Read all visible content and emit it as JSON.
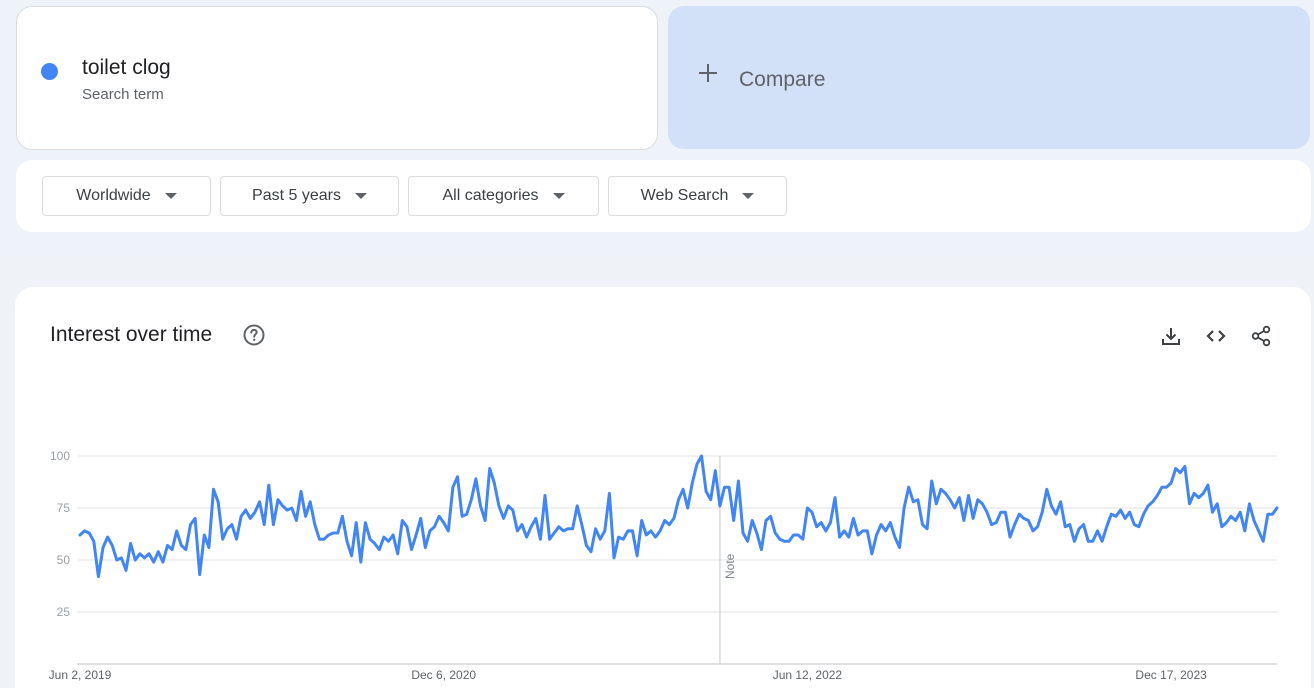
{
  "search_term": {
    "name": "toilet clog",
    "subtitle": "Search term",
    "color": "#4285f4"
  },
  "compare": {
    "label": "Compare"
  },
  "filters": {
    "region": "Worldwide",
    "period": "Past 5 years",
    "category": "All categories",
    "property": "Web Search"
  },
  "chart_card": {
    "title": "Interest over time",
    "note": "Note",
    "icons": [
      "help-icon",
      "download-icon",
      "embed-code-icon",
      "share-icon"
    ]
  },
  "chart_data": {
    "type": "line",
    "title": "Interest over time",
    "xlabel": "",
    "ylabel": "",
    "ylim": [
      0,
      100
    ],
    "yticks": [
      25,
      50,
      75,
      100
    ],
    "x_tick_labels": [
      "Jun 2, 2019",
      "Dec 6, 2020",
      "Jun 12, 2022",
      "Dec 17, 2023"
    ],
    "x_tick_index": [
      0,
      79,
      158,
      237
    ],
    "note_index": 139,
    "grid": true,
    "legend": "none",
    "series": [
      {
        "color": "#4285f4",
        "values": [
          62,
          64,
          63,
          59,
          42,
          56,
          61,
          57,
          50,
          51,
          45,
          58,
          50,
          53,
          51,
          53,
          49,
          54,
          49,
          57,
          55,
          64,
          57,
          55,
          67,
          70,
          43,
          62,
          56,
          84,
          78,
          60,
          65,
          67,
          60,
          71,
          74,
          70,
          73,
          78,
          67,
          86,
          67,
          79,
          76,
          74,
          75,
          69,
          83,
          71,
          78,
          67,
          60,
          60,
          62,
          63,
          63,
          71,
          59,
          52,
          68,
          49,
          68,
          60,
          58,
          55,
          61,
          59,
          62,
          53,
          69,
          66,
          55,
          62,
          70,
          56,
          64,
          66,
          71,
          68,
          64,
          85,
          90,
          71,
          72,
          79,
          89,
          76,
          69,
          94,
          87,
          76,
          70,
          76,
          74,
          64,
          67,
          61,
          66,
          70,
          60,
          81,
          60,
          63,
          66,
          64,
          65,
          65,
          76,
          67,
          57,
          54,
          65,
          60,
          64,
          82,
          51,
          61,
          60,
          64,
          64,
          52,
          69,
          62,
          64,
          61,
          64,
          69,
          67,
          70,
          79,
          84,
          75,
          87,
          96,
          100,
          83,
          79,
          93,
          76,
          85,
          85,
          69,
          88,
          63,
          59,
          69,
          63,
          55,
          69,
          71,
          63,
          60,
          59,
          59,
          62,
          62,
          60,
          75,
          73,
          66,
          68,
          64,
          68,
          80,
          61,
          64,
          61,
          70,
          62,
          64,
          64,
          53,
          62,
          67,
          64,
          68,
          61,
          56,
          75,
          85,
          78,
          79,
          67,
          65,
          88,
          77,
          84,
          82,
          79,
          75,
          80,
          69,
          81,
          70,
          79,
          77,
          73,
          67,
          68,
          73,
          73,
          61,
          67,
          72,
          70,
          69,
          64,
          66,
          73,
          84,
          76,
          72,
          78,
          66,
          67,
          59,
          65,
          67,
          59,
          59,
          64,
          59,
          66,
          72,
          71,
          74,
          70,
          73,
          67,
          66,
          72,
          76,
          78,
          81,
          85,
          85,
          87,
          94,
          92,
          95,
          77,
          82,
          80,
          82,
          86,
          73,
          77,
          66,
          68,
          71,
          69,
          73,
          64,
          77,
          69,
          64,
          59,
          72,
          72,
          75
        ]
      }
    ]
  }
}
